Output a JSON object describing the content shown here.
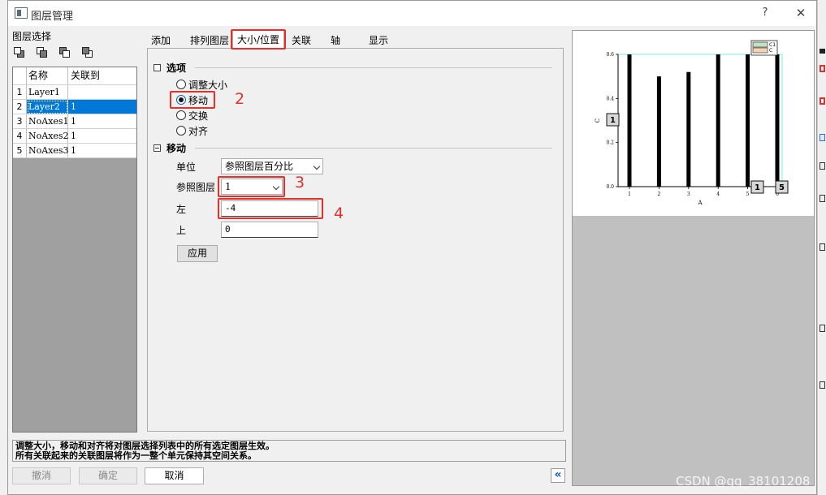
{
  "window": {
    "title": "图层管理",
    "help": "?",
    "close": "✕"
  },
  "layer_select": {
    "label": "图层选择",
    "columns": [
      "名称",
      "关联到"
    ],
    "rows": [
      {
        "index": "1",
        "name": "Layer1",
        "link": ""
      },
      {
        "index": "2",
        "name": "Layer2",
        "link": "1",
        "selected": true
      },
      {
        "index": "3",
        "name": "NoAxes1",
        "link": "1"
      },
      {
        "index": "4",
        "name": "NoAxes2",
        "link": "1"
      },
      {
        "index": "5",
        "name": "NoAxes3",
        "link": "1"
      }
    ]
  },
  "tabs": [
    {
      "label": "添加"
    },
    {
      "label": "排列图层"
    },
    {
      "label": "大小/位置",
      "active": true
    },
    {
      "label": "关联"
    },
    {
      "label": "轴"
    },
    {
      "label": "显示"
    }
  ],
  "options": {
    "title": "选项",
    "radios": [
      {
        "label": "调整大小",
        "checked": false
      },
      {
        "label": "移动",
        "checked": true
      },
      {
        "label": "交换",
        "checked": false
      },
      {
        "label": "对齐",
        "checked": false
      }
    ]
  },
  "move": {
    "title": "移动",
    "unit_label": "单位",
    "unit_value": "参照图层百分比",
    "ref_layer_label": "参照图层",
    "ref_layer_value": "1",
    "left_label": "左",
    "left_value": "-4",
    "top_label": "上",
    "top_value": "0",
    "apply": "应用"
  },
  "annotations": [
    "1",
    "2",
    "3",
    "4"
  ],
  "preview": {
    "legend": [
      "C1",
      "C"
    ],
    "legend_colors": [
      "#bfe3c0",
      "#f5d2b0"
    ],
    "y_axis_label": "C",
    "x_axis_label": "A",
    "layer_badges": [
      "1",
      "1",
      "5"
    ]
  },
  "chart_data": {
    "type": "bar",
    "categories": [
      "1",
      "2",
      "3",
      "4",
      "5",
      "6"
    ],
    "values": [
      0.6,
      0.5,
      0.52,
      0.6,
      0.6,
      0.6
    ],
    "y_ticks": [
      "0.0",
      "0.2",
      "0.4",
      "0.6"
    ],
    "ylim": [
      0,
      0.6
    ],
    "xlabel": "A",
    "ylabel": "C",
    "bar_color": "#000000",
    "frame_color": "#7fe8ef"
  },
  "status": {
    "line1": "调整大小，移动和对齐将对图层选择列表中的所有选定图层生效。",
    "line2": "所有关联起来的关联图层将作为一整个单元保持其空间关系。"
  },
  "buttons": {
    "undo": "撤消",
    "ok": "确定",
    "cancel": "取消",
    "collapse": "«"
  },
  "watermark": "CSDN @qq_38101208"
}
